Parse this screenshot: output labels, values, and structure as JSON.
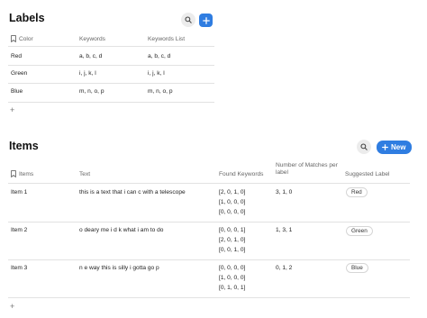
{
  "labels": {
    "title": "Labels",
    "columns": [
      "Color",
      "Keywords",
      "Keywords List"
    ],
    "rows": [
      {
        "color": "Red",
        "keywords": "a, b, c, d",
        "list": "a, b, c, d"
      },
      {
        "color": "Green",
        "keywords": "i, j, k, l",
        "list": "i, j, k, l"
      },
      {
        "color": "Blue",
        "keywords": "m, n, o, p",
        "list": "m, n, o, p"
      }
    ],
    "add_symbol": "+"
  },
  "items": {
    "title": "Items",
    "new_button_label": "New",
    "columns": [
      "Items",
      "Text",
      "Found Keywords",
      "Number of Matches per label",
      "Suggested Label"
    ],
    "rows": [
      {
        "name": "Item 1",
        "text": "this is a text that i can c with a telescope",
        "found": [
          "[2, 0, 1, 0]",
          "[1, 0, 0, 0]",
          "[0, 0, 0, 0]"
        ],
        "matches": "3, 1, 0",
        "label": "Red"
      },
      {
        "name": "Item 2",
        "text": "o deary me i d k what i am to do",
        "found": [
          "[0, 0, 0, 1]",
          "[2, 0, 1, 0]",
          "[0, 0, 1, 0]"
        ],
        "matches": "1, 3, 1",
        "label": "Green"
      },
      {
        "name": "Item 3",
        "text": "n e way this is silly i gotta go p",
        "found": [
          "[0, 0, 0, 0]",
          "[1, 0, 0, 0]",
          "[0, 1, 0, 1]"
        ],
        "matches": "0, 1, 2",
        "label": "Blue"
      }
    ],
    "add_symbol": "+"
  },
  "icons": {
    "search": "search-icon",
    "add": "plus-icon",
    "bookmark": "bookmark-icon"
  },
  "colors": {
    "accent": "#2f7de1"
  }
}
